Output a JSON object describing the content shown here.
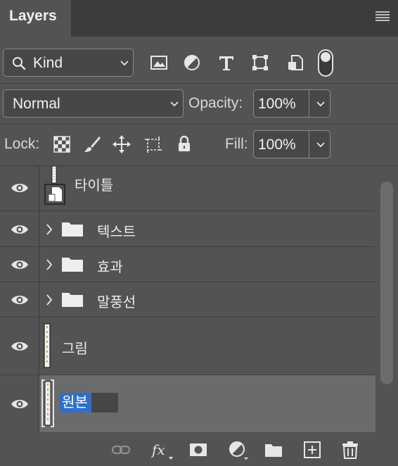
{
  "panel": {
    "tab_title": "Layers"
  },
  "filter": {
    "kind_label": "Kind",
    "icons": [
      "image-filter-icon",
      "adjustment-filter-icon",
      "type-filter-icon",
      "shape-filter-icon",
      "smart-object-filter-icon"
    ]
  },
  "blend": {
    "mode": "Normal",
    "opacity_label": "Opacity:",
    "opacity_value": "100%"
  },
  "lock": {
    "label": "Lock:",
    "fill_label": "Fill:",
    "fill_value": "100%"
  },
  "layers": [
    {
      "name": "타이틀",
      "type": "smart-object",
      "visible": true
    },
    {
      "name": "텍스트",
      "type": "group",
      "visible": true
    },
    {
      "name": "효과",
      "type": "group",
      "visible": true
    },
    {
      "name": "말풍선",
      "type": "group",
      "visible": true
    },
    {
      "name": "그림",
      "type": "layer",
      "visible": true
    },
    {
      "name": "원본",
      "type": "layer",
      "visible": true,
      "selected": true,
      "renaming": true
    }
  ],
  "colors": {
    "panel_bg": "#535353",
    "header_bg": "#3c3c3c",
    "selected_row": "#6b6b6b",
    "text_highlight": "#2f6fc7"
  }
}
